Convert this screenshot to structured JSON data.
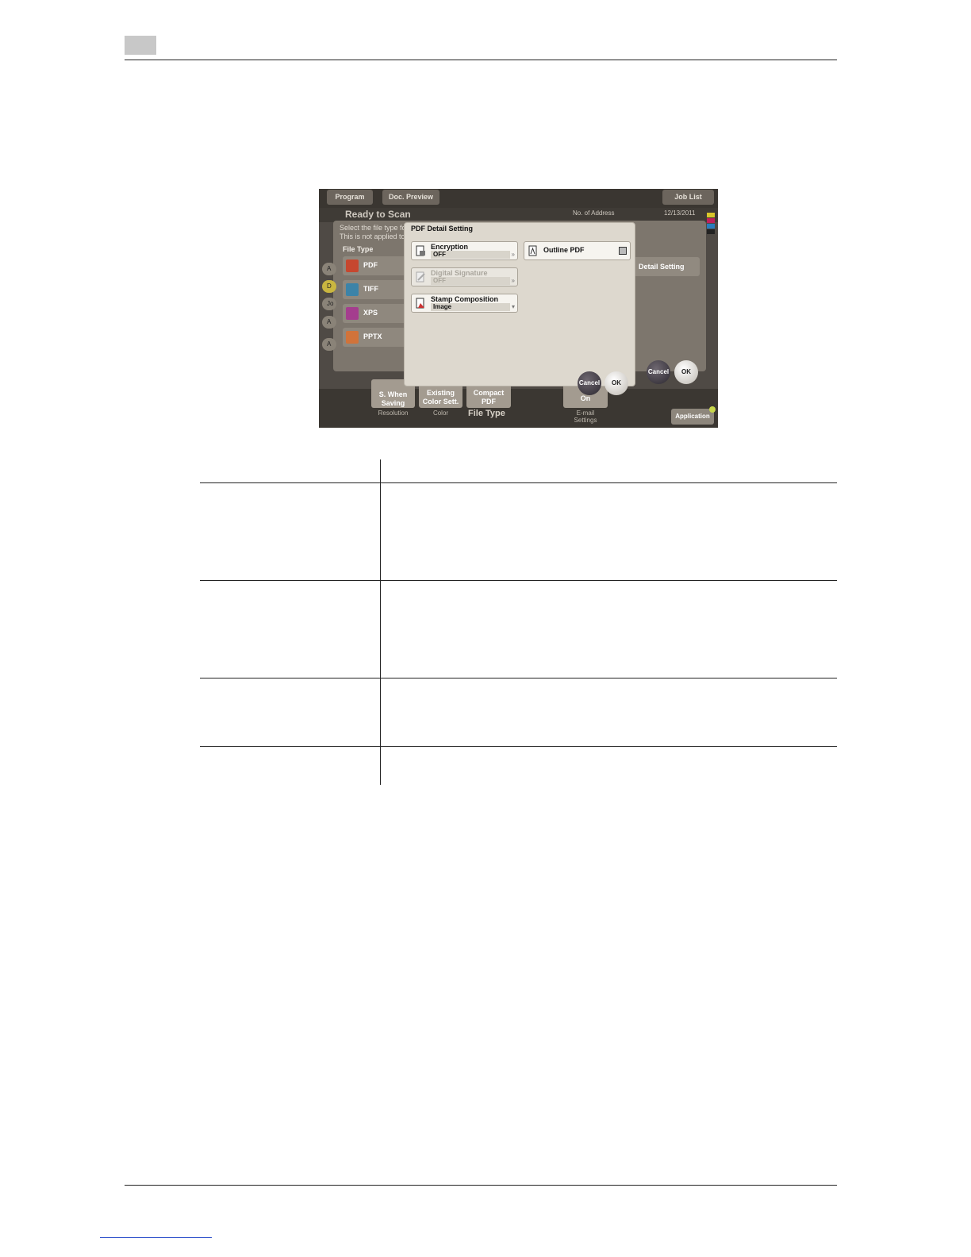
{
  "screen": {
    "top_tabs": {
      "program": "Program",
      "doc_preview": "Doc. Preview",
      "job_list": "Job List"
    },
    "status": {
      "ready": "Ready to Scan",
      "address_label": "No. of Address",
      "date": "12/13/2011"
    },
    "background": {
      "hint_line1": "Select the file type fo",
      "hint_line2": "This is not applied to",
      "file_type_label": "File Type",
      "file_types": [
        "PDF",
        "TIFF",
        "XPS",
        "PPTX"
      ],
      "left_tabs": [
        "A",
        "D",
        "Jo",
        "A",
        "A"
      ],
      "detail_setting": "Detail Setting",
      "cancel": "Cancel",
      "ok": "OK"
    },
    "dialog": {
      "title": "PDF Detail Setting",
      "encryption": {
        "label": "Encryption",
        "value": "OFF"
      },
      "digital_signature": {
        "label": "Digital Signature",
        "value": "OFF"
      },
      "stamp_composition": {
        "label": "Stamp Composition",
        "value": "Image"
      },
      "outline_pdf": {
        "label": "Outline PDF"
      },
      "cancel": "Cancel",
      "ok": "OK"
    },
    "bottom": {
      "saving_line1": "S. When",
      "saving_line2": "Saving",
      "existing_line1": "Existing",
      "existing_line2": "Color Sett.",
      "compact_line1": "Compact",
      "compact_line2": "PDF",
      "on_label": "On",
      "resolution": "Resolution",
      "color": "Color",
      "file_type": "File Type",
      "email_line1": "E-mail",
      "email_line2": "Settings",
      "application": "Application"
    },
    "colors": {
      "toner": [
        "#d9c62b",
        "#c0215b",
        "#2a7dbf",
        "#222222"
      ]
    }
  }
}
